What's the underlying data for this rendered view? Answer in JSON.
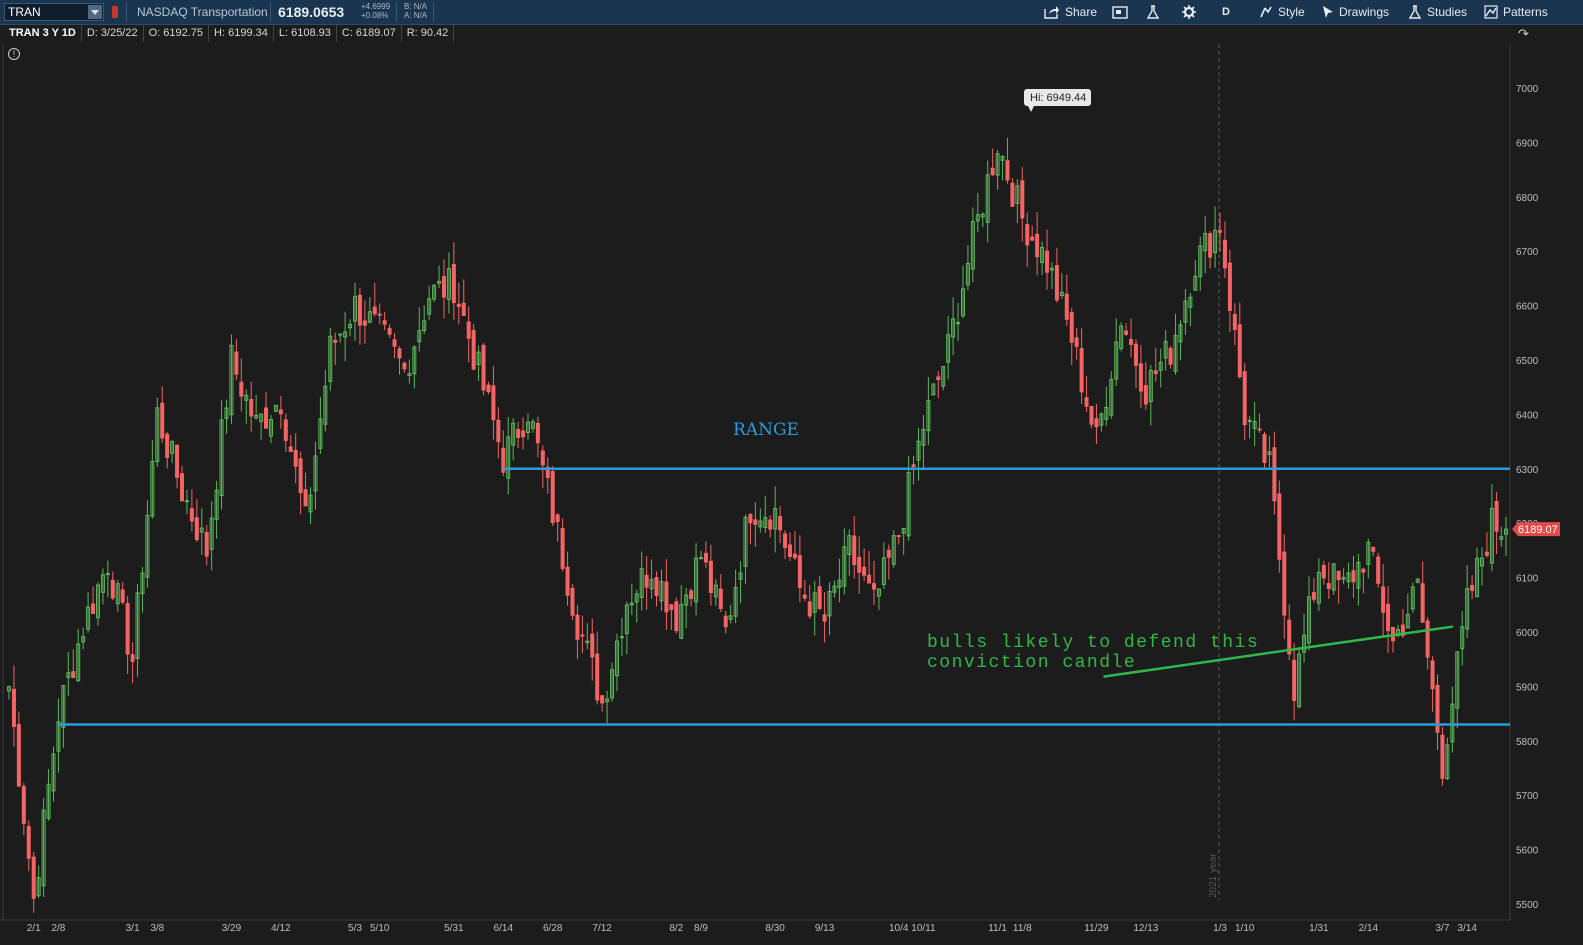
{
  "toolbar": {
    "symbol": "TRAN",
    "symbol_name": "NASDAQ Transportation",
    "last_price": "6189.0653",
    "change": "+4.6999",
    "change_pct": "+0.08%",
    "bid": "B: N/A",
    "ask": "A: N/A",
    "share": "Share",
    "period": "D",
    "style": "Style",
    "drawings": "Drawings",
    "studies": "Studies",
    "patterns": "Patterns"
  },
  "info_bar": {
    "title": "TRAN 3 Y 1D",
    "date": "D: 3/25/22",
    "open": "O: 6192.75",
    "high": "H: 6199.34",
    "low": "L: 6108.93",
    "close": "C: 6189.07",
    "range": "R: 90.42"
  },
  "chart_data": {
    "type": "candlestick",
    "y_ticks": [
      5500,
      5600,
      5700,
      5800,
      5900,
      6000,
      6100,
      6200,
      6300,
      6400,
      6500,
      6600,
      6700,
      6800,
      6900,
      7000
    ],
    "ylim": [
      5475,
      7065
    ],
    "x_tick_labels": [
      "2/1",
      "2/8",
      "3/1",
      "3/8",
      "3/29",
      "4/12",
      "5/3",
      "5/10",
      "5/31",
      "6/14",
      "6/28",
      "7/12",
      "8/2",
      "8/9",
      "8/30",
      "9/13",
      "10/4",
      "10/11",
      "11/1",
      "11/8",
      "11/29",
      "12/13",
      "1/3",
      "1/10",
      "1/31",
      "2/14",
      "3/7",
      "3/14"
    ],
    "year_marker": "2021 year",
    "last_price_label": "6189.07",
    "hi_label": "Hi: 6949.44",
    "annotations": {
      "range_label": "RANGE",
      "note_line1": "bulls likely to defend this",
      "note_line2": "conviction candle"
    },
    "levels": [
      {
        "value": 6300,
        "from": "6/14",
        "color": "#2a9bdc"
      },
      {
        "value": 5830,
        "from": "2/8",
        "color": "#2a9bdc"
      }
    ],
    "trendline": {
      "from": [
        "12/1",
        5918
      ],
      "to": [
        "3/10",
        6010
      ],
      "color": "#2fb84a"
    },
    "colors": {
      "up": "#5cb85c",
      "down": "#f46464",
      "background": "#1c1c1c"
    },
    "anchors": [
      [
        "1/25",
        5900
      ],
      [
        "2/1",
        5510
      ],
      [
        "2/8",
        5850
      ],
      [
        "2/15",
        6010
      ],
      [
        "2/22",
        6130
      ],
      [
        "3/1",
        5950
      ],
      [
        "3/8",
        6400
      ],
      [
        "3/15",
        6260
      ],
      [
        "3/22",
        6150
      ],
      [
        "3/29",
        6500
      ],
      [
        "4/5",
        6380
      ],
      [
        "4/12",
        6430
      ],
      [
        "4/19",
        6200
      ],
      [
        "4/26",
        6520
      ],
      [
        "5/3",
        6600
      ],
      [
        "5/10",
        6550
      ],
      [
        "5/17",
        6480
      ],
      [
        "5/24",
        6620
      ],
      [
        "5/31",
        6640
      ],
      [
        "6/7",
        6480
      ],
      [
        "6/14",
        6320
      ],
      [
        "6/21",
        6410
      ],
      [
        "6/28",
        6220
      ],
      [
        "7/5",
        6020
      ],
      [
        "7/12",
        5870
      ],
      [
        "7/19",
        6060
      ],
      [
        "7/26",
        6120
      ],
      [
        "8/2",
        6030
      ],
      [
        "8/9",
        6140
      ],
      [
        "8/16",
        6000
      ],
      [
        "8/23",
        6230
      ],
      [
        "8/30",
        6220
      ],
      [
        "9/6",
        6080
      ],
      [
        "9/13",
        6020
      ],
      [
        "9/20",
        6150
      ],
      [
        "9/27",
        6050
      ],
      [
        "10/4",
        6180
      ],
      [
        "10/11",
        6380
      ],
      [
        "10/18",
        6520
      ],
      [
        "10/25",
        6720
      ],
      [
        "11/1",
        6900
      ],
      [
        "11/8",
        6760
      ],
      [
        "11/15",
        6680
      ],
      [
        "11/22",
        6540
      ],
      [
        "11/29",
        6350
      ],
      [
        "12/6",
        6580
      ],
      [
        "12/13",
        6450
      ],
      [
        "12/20",
        6520
      ],
      [
        "12/27",
        6680
      ],
      [
        "1/3",
        6750
      ],
      [
        "1/10",
        6400
      ],
      [
        "1/17",
        6300
      ],
      [
        "1/24",
        5900
      ],
      [
        "1/31",
        6120
      ],
      [
        "2/7",
        6080
      ],
      [
        "2/14",
        6150
      ],
      [
        "2/21",
        5980
      ],
      [
        "2/28",
        6080
      ],
      [
        "3/7",
        5760
      ],
      [
        "3/14",
        6050
      ],
      [
        "3/21",
        6200
      ],
      [
        "3/25",
        6189
      ]
    ]
  }
}
